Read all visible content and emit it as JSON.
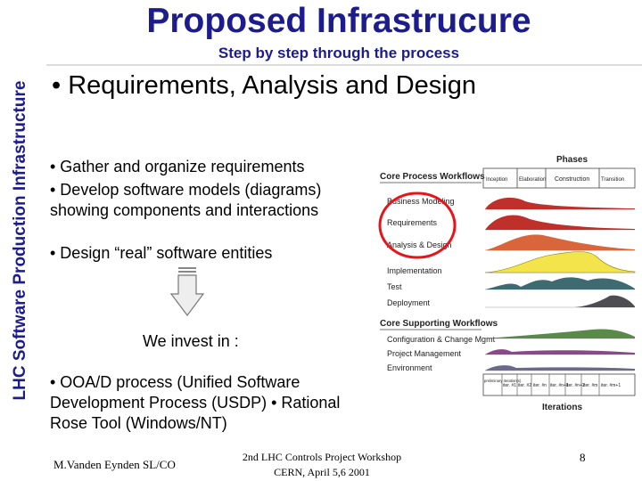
{
  "sidebar": {
    "text": "LHC Software Production Infrastructure"
  },
  "header": {
    "title": "Proposed Infrastrucure",
    "subtitle": "Step by step through the process"
  },
  "main": {
    "bullet": "• Requirements, Analysis and Design",
    "sub_bullets": [
      "• Gather and organize requirements",
      "• Develop  software models (diagrams) showing components and interactions",
      "• Design “real” software entities"
    ],
    "invest_text": "We invest in :",
    "tools_text": "• OOA/D process (Unified Software Development Process (USDP) • Rational Rose Tool (Windows/NT)"
  },
  "diagram": {
    "phases_title": "Phases",
    "core_process_title": "Core Process Workflows",
    "core_supporting_title": "Core Supporting Workflows",
    "iterations_label": "Iterations",
    "phases": [
      "Inception",
      "Elaboration",
      "Construction",
      "Transition"
    ],
    "workflows": [
      "Business Modeling",
      "Requirements",
      "Analysis & Design",
      "Implementation",
      "Test",
      "Deployment"
    ],
    "supporting": [
      "Configuration & Change Mgmt",
      "Project Management",
      "Environment"
    ],
    "iterations": [
      "preliminary iteration(s)",
      "iter. #1",
      "iter. #2",
      "iter. #n",
      "iter. #n+1",
      "iter. #n+2",
      "iter. #m",
      "iter. #m+1"
    ],
    "highlight_color": "#e8141c"
  },
  "footer": {
    "left": "M.Vanden Eynden SL/CO",
    "center_line1": "2nd LHC Controls Project Workshop",
    "center_line2": "CERN, April 5,6 2001",
    "page": "8"
  }
}
